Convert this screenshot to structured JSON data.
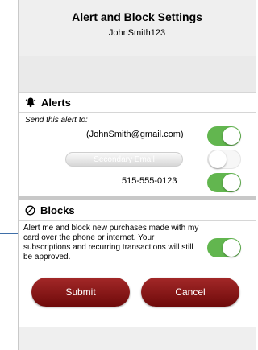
{
  "header": {
    "title": "Alert and Block Settings",
    "username": "JohnSmith123"
  },
  "alerts": {
    "heading": "Alerts",
    "send_label": "Send this alert to:",
    "primary_email": "(JohnSmith@gmail.com)",
    "primary_email_enabled": true,
    "secondary_email_placeholder": "Secondary Email",
    "secondary_email_enabled": false,
    "phone": "515-555-0123",
    "phone_enabled": true
  },
  "blocks": {
    "heading": "Blocks",
    "description": "Alert me and block new purchases made with my card over the phone or internet. Your subscriptions and recurring transactions will still be approved.",
    "enabled": true
  },
  "actions": {
    "submit_label": "Submit",
    "cancel_label": "Cancel"
  },
  "colors": {
    "toggle_on": "#62b64f",
    "button": "#8c1a1a",
    "pointer_arrow": "#3f6fa8"
  }
}
